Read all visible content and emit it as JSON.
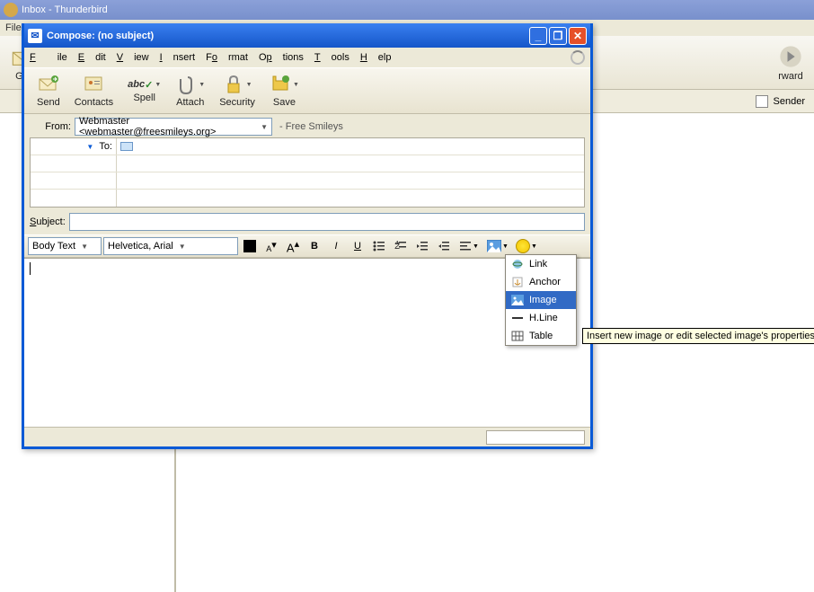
{
  "main_window": {
    "title": "Inbox - Thunderbird",
    "menu": [
      "File"
    ],
    "toolbar": {
      "get": "Get",
      "forward": "rward"
    },
    "sender_label": "Sender"
  },
  "compose": {
    "title": "Compose: (no subject)",
    "menu": {
      "file": "File",
      "edit": "Edit",
      "view": "View",
      "insert": "Insert",
      "format": "Format",
      "options": "Options",
      "tools": "Tools",
      "help": "Help"
    },
    "toolbar": {
      "send": "Send",
      "contacts": "Contacts",
      "spell": "Spell",
      "attach": "Attach",
      "security": "Security",
      "save": "Save"
    },
    "from_label": "From:",
    "from_value": "Webmaster <webmaster@freesmileys.org>",
    "identity": "- Free Smileys",
    "to_label": "To:",
    "subject_label_u": "S",
    "subject_label_rest": "ubject:",
    "format_bar": {
      "para": "Body Text",
      "font": "Helvetica, Arial"
    }
  },
  "insert_menu": {
    "link": "Link",
    "anchor": "Anchor",
    "image": "Image",
    "hline": "H.Line",
    "table": "Table"
  },
  "tooltip": "Insert new image or edit selected image's properties"
}
